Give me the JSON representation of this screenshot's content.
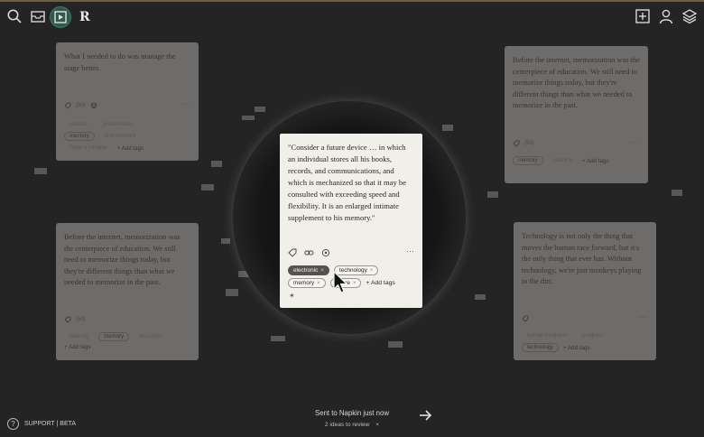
{
  "app": {
    "logo": "R"
  },
  "cards": {
    "top_left": {
      "text": "What I needed to do was manage the stage better.",
      "count": "(50)",
      "tags_row1": [
        "capture",
        "presentation"
      ],
      "tags_row2": [
        "memory",
        "improvement"
      ],
      "tags_row3": [
        "Clear a mistake"
      ],
      "add_tags": "Add tags"
    },
    "top_right": {
      "text": "Before the internet, memorization was the centerpiece of education. We still need to memorize things today, but they're different things than what we needed to memorize in the past.",
      "count": "(50)",
      "tags_row1": [
        "memory",
        "learning"
      ],
      "add_tags": "Add tags"
    },
    "bottom_left": {
      "text": "Before the internet, memorization was the centerpiece of education. We still need to memorize things today, but they're different things than what we needed to memorize in the past.",
      "count": "(50)",
      "tags_row1": [
        "learning",
        "memory",
        "education"
      ],
      "add_tags": "Add tags"
    },
    "bottom_right": {
      "text": "Technology is not only the thing that moves the human race forward, but it's the only thing that ever has. Without technology, we're just monkeys playing in the dirt.",
      "tags_row1": [
        "human evolution",
        "progress"
      ],
      "tags_row2": [
        "technology"
      ],
      "add_tags": "Add tags"
    },
    "main": {
      "text": "\"Consider a future device … in which an individual stores all his books, records, and communications, and which is mechanized so that it may be consulted with exceeding speed and flexibility. It is an enlarged intimate supplement to his memory.\"",
      "tags_row1": [
        "electronic",
        "technology"
      ],
      "tags_row2": [
        "memory",
        "future"
      ],
      "add_tags": "Add tags",
      "dots": "···"
    }
  },
  "footer": {
    "support": "SUPPORT | BETA",
    "help": "?",
    "toast_title": "Sent to Napkin just now",
    "toast_sub": "2 ideas to review",
    "toast_close": "×"
  },
  "colors": {
    "accent": "#2f5a4a",
    "card_main": "#f1efe9",
    "card_dim": "#6e6c6a"
  }
}
